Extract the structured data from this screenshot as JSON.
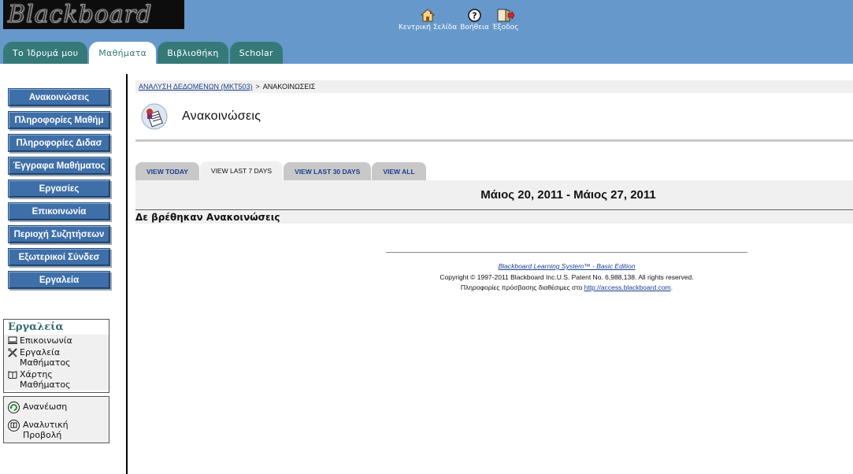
{
  "header": {
    "logo_text": "Blackboard",
    "links": [
      {
        "label": "Κεντρική Σελίδα",
        "icon": "home-icon"
      },
      {
        "label": "Βοήθεια",
        "icon": "help-icon"
      },
      {
        "label": "Έξοδος",
        "icon": "logout-icon"
      }
    ],
    "tabs": [
      {
        "label": "Το Ίδρυμά μου",
        "active": false
      },
      {
        "label": "Μαθήματα",
        "active": true
      },
      {
        "label": "Βιβλιοθήκη",
        "active": false
      },
      {
        "label": "Scholar",
        "active": false
      }
    ]
  },
  "course_menu": {
    "buttons": [
      "Ανακοινώσεις",
      "Πληροφορίες Μαθήμ",
      "Πληροφορίες Διδασ",
      "Έγγραφα Μαθήματος",
      "Εργασίες",
      "Επικοινωνία",
      "Περιοχή Συζητήσεων",
      "Εξωτερικοί Σύνδεσ",
      "Εργαλεία"
    ],
    "tools_box": {
      "title": "Εργαλεία",
      "items": [
        {
          "label": "Επικοινωνία",
          "icon": "communication-icon"
        },
        {
          "label": "Εργαλεία Μαθήματος",
          "icon": "tools-icon"
        },
        {
          "label": "Χάρτης Μαθήματος",
          "icon": "book-icon"
        }
      ]
    },
    "view_box": {
      "items": [
        {
          "label": "Ανανέωση",
          "icon": "refresh-icon"
        },
        {
          "label": "Αναλυτική Προβολή",
          "icon": "detail-view-icon"
        }
      ]
    }
  },
  "breadcrumb": {
    "course_link": "ΑΝΑΛΥΣΗ ΔΕΔΟΜΕΝΩΝ (MKT503)",
    "separator": ">",
    "current": "ΑΝΑΚΟΙΝΩΣΕΙΣ"
  },
  "page": {
    "title": "Ανακοινώσεις",
    "view_tabs": [
      {
        "label": "VIEW TODAY",
        "active": false
      },
      {
        "label": "VIEW LAST 7 DAYS",
        "active": true
      },
      {
        "label": "VIEW LAST 30 DAYS",
        "active": false
      },
      {
        "label": "VIEW ALL",
        "active": false
      }
    ],
    "date_range": "Μάιος 20, 2011 - Μάιος 27, 2011",
    "empty_message": "Δε βρέθηκαν Ανακοινώσεις"
  },
  "footer": {
    "product_link": "Blackboard Learning System™ - Basic Edition",
    "copyright": "Copyright © 1997-2011 Blackboard Inc.U.S. Patent No. 6,988,138. All rights reserved.",
    "access_prefix": "Πληροφορίες πρόσβασης διαθέσιμες στο ",
    "access_link": "http://access.blackboard.com",
    "access_suffix": "."
  },
  "colors": {
    "header_bg": "#6698cb",
    "tab_bg": "#357a79",
    "nav_button_bg": "#3f6fa8",
    "link": "#1a3f8e"
  }
}
